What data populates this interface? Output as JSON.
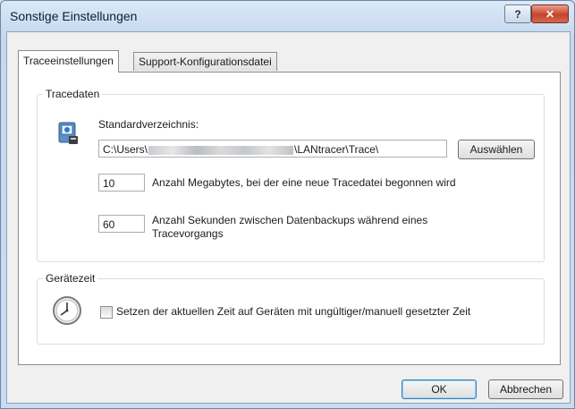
{
  "window": {
    "title": "Sonstige Einstellungen",
    "help_label": "?",
    "close_label": "✕"
  },
  "tabs": [
    {
      "label": "Traceeinstellungen",
      "active": true
    },
    {
      "label": "Support-Konfigurationsdatei",
      "active": false
    }
  ],
  "tracedaten": {
    "legend": "Tracedaten",
    "dir_label": "Standardverzeichnis:",
    "dir_value_start": "C:\\Users\\",
    "dir_value_end": "\\LANtracer\\Trace\\",
    "select_button": "Auswählen",
    "megabytes_value": "10",
    "megabytes_label": "Anzahl Megabytes, bei der eine neue Tracedatei begonnen wird",
    "seconds_value": "60",
    "seconds_label_line1": "Anzahl Sekunden zwischen Datenbackups während eines",
    "seconds_label_line2": "Tracevorgangs"
  },
  "geraetezeit": {
    "legend": "Gerätezeit",
    "checkbox_label": "Setzen der aktuellen Zeit auf Geräten mit ungültiger/manuell gesetzter Zeit",
    "checked": false
  },
  "footer": {
    "ok_label": "OK",
    "cancel_label": "Abbrechen"
  },
  "icons": {
    "folder": "folder-settings-icon",
    "clock": "clock-icon"
  }
}
